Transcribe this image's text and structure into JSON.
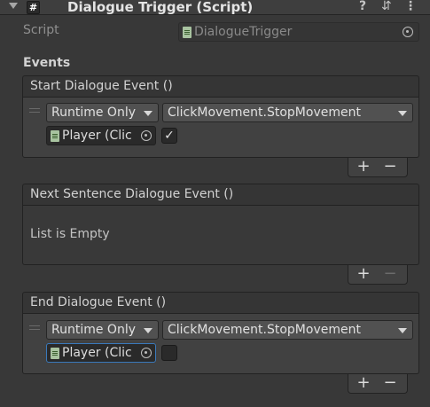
{
  "header": {
    "title": "Dialogue Trigger (Script)",
    "script_icon": "#",
    "help_icon": "?",
    "presets_icon": "⇵",
    "menu_icon": "⋮"
  },
  "script": {
    "label": "Script",
    "value": "DialogueTrigger"
  },
  "events_label": "Events",
  "events": [
    {
      "title": "Start Dialogue Event ()",
      "runtime": "Runtime Only",
      "function": "ClickMovement.StopMovement",
      "target": "Player (Clic",
      "checked": "✓"
    },
    {
      "title": "Next Sentence Dialogue Event ()",
      "empty_text": "List is Empty"
    },
    {
      "title": "End Dialogue Event ()",
      "runtime": "Runtime Only",
      "function": "ClickMovement.StopMovement",
      "target": "Player (Clic",
      "checked": ""
    }
  ],
  "buttons": {
    "plus": "+",
    "minus": "−"
  },
  "colors": {
    "background": "#383838",
    "focus_outline": "#3a79bb"
  }
}
